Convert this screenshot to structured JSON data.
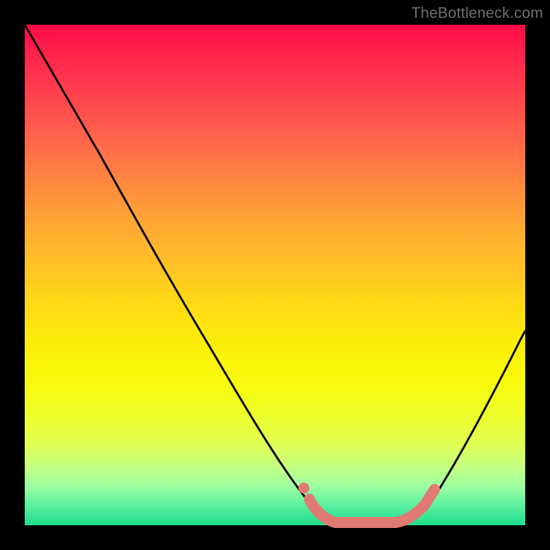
{
  "watermark": {
    "text": "TheBottleneck.com"
  },
  "colors": {
    "background": "#000000",
    "curve": "#000000",
    "highlight": "#e07a72"
  },
  "chart_data": {
    "type": "line",
    "title": "",
    "xlabel": "",
    "ylabel": "",
    "xlim": [
      0,
      100
    ],
    "ylim": [
      0,
      100
    ],
    "grid": false,
    "series": [
      {
        "name": "bottleneck-curve",
        "x": [
          0,
          6,
          12,
          18,
          24,
          30,
          36,
          42,
          48,
          54,
          58,
          60,
          63,
          66,
          70,
          74,
          78,
          82,
          86,
          90,
          94,
          98,
          100
        ],
        "values": [
          100,
          91,
          82,
          73,
          64,
          55,
          46,
          37,
          28,
          18,
          8,
          2,
          0,
          0,
          0,
          0,
          2,
          8,
          16,
          24,
          34,
          44,
          49
        ]
      }
    ],
    "annotations": [
      {
        "name": "optimal-zone-highlight",
        "x_range": [
          58,
          78
        ],
        "style": "pink-thick"
      }
    ]
  }
}
